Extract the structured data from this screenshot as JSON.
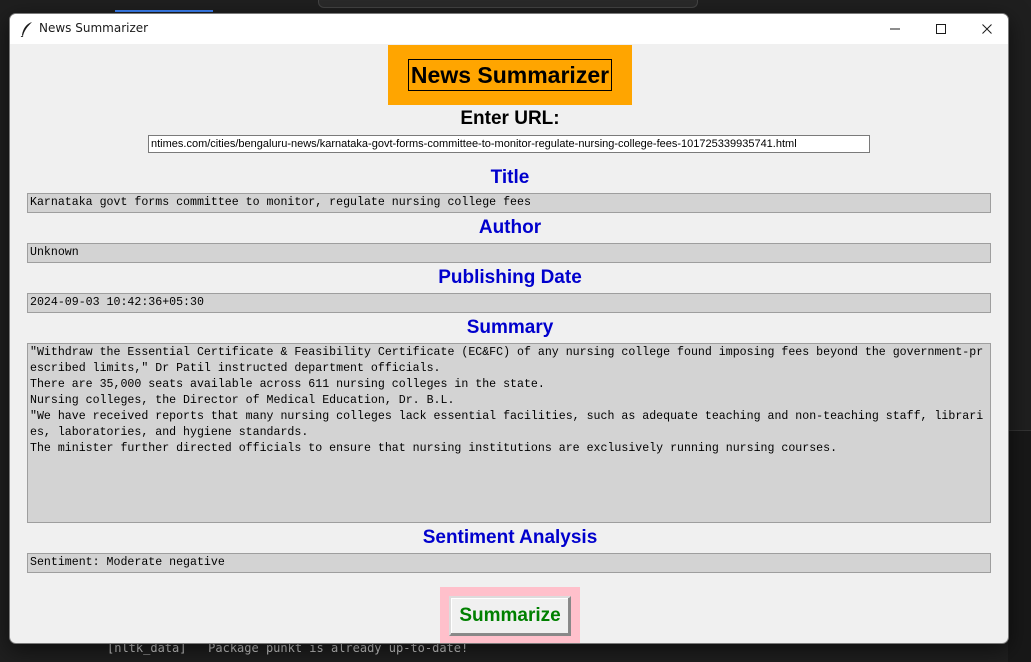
{
  "window": {
    "title": "News Summarizer"
  },
  "app": {
    "heading": "News Summarizer",
    "url_label": "Enter URL:",
    "url_value": "ntimes.com/cities/bengaluru-news/karnataka-govt-forms-committee-to-monitor-regulate-nursing-college-fees-101725339935741.html",
    "sections": {
      "title": {
        "label": "Title",
        "value": "Karnataka govt forms committee to monitor, regulate nursing college fees"
      },
      "author": {
        "label": "Author",
        "value": "Unknown"
      },
      "date": {
        "label": "Publishing Date",
        "value": "2024-09-03 10:42:36+05:30"
      },
      "summary": {
        "label": "Summary",
        "value": "\"Withdraw the Essential Certificate & Feasibility Certificate (EC&FC) of any nursing college found imposing fees beyond the government-prescribed limits,\" Dr Patil instructed department officials.\nThere are 35,000 seats available across 611 nursing colleges in the state.\nNursing colleges, the Director of Medical Education, Dr. B.L.\n\"We have received reports that many nursing colleges lack essential facilities, such as adequate teaching and non-teaching staff, libraries, laboratories, and hygiene standards.\nThe minister further directed officials to ensure that nursing institutions are exclusively running nursing courses."
      },
      "sentiment": {
        "label": "Sentiment Analysis",
        "value": "Sentiment: Moderate negative"
      }
    },
    "summarize_label": "Summarize"
  },
  "background": {
    "terminal_line": "[nltk_data]   Package punkt is already up-to-date!"
  },
  "colors": {
    "heading_bg": "#ffa500",
    "section_label": "#0000cd",
    "field_bg": "#d3d3d3",
    "button_frame": "#ffc0cb",
    "button_text": "#008000"
  },
  "icons": [
    "feather-icon",
    "minimize-icon",
    "maximize-icon",
    "close-icon"
  ]
}
